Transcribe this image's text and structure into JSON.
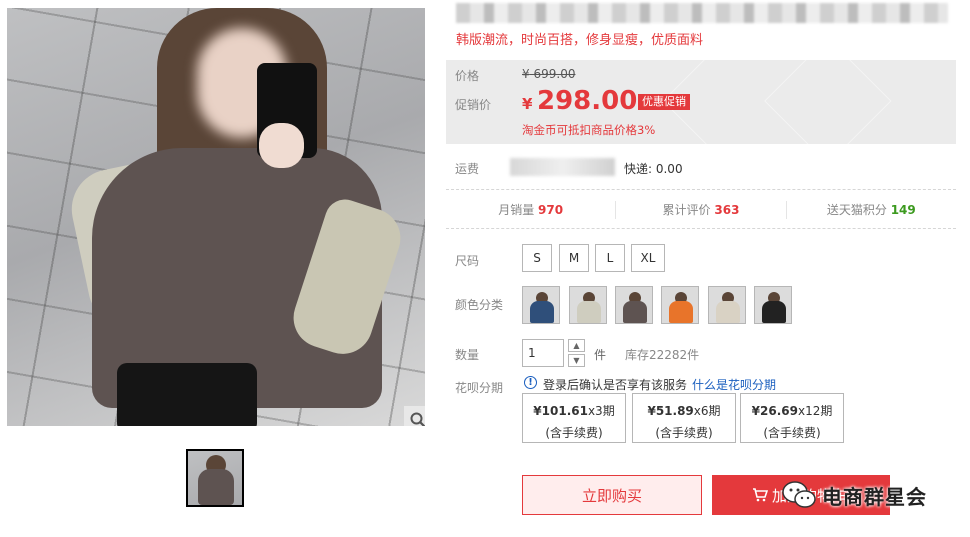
{
  "product": {
    "subtitle": "韩版潮流，时尚百搭，修身显瘦，优质面料"
  },
  "price": {
    "orig_label": "价格",
    "orig_currency": "¥",
    "orig_value": "699.00",
    "promo_label": "促销价",
    "currency": "¥",
    "value": "298.00",
    "promo_tag": "优惠促销",
    "coin_note": "淘金币可抵扣商品价格3%"
  },
  "shipping": {
    "label": "运费",
    "value": "快递: 0.00"
  },
  "stats": {
    "monthly_label": "月销量",
    "monthly_value": "970",
    "reviews_label": "累计评价",
    "reviews_value": "363",
    "points_label": "送天猫积分",
    "points_value": "149"
  },
  "size": {
    "label": "尺码",
    "options": [
      "S",
      "M",
      "L",
      "XL"
    ]
  },
  "color": {
    "label": "颜色分类",
    "swatches": [
      "#2f4f7a",
      "#cfcdbf",
      "#5e5351",
      "#e8742a",
      "#d9d2c4",
      "#222222"
    ]
  },
  "quantity": {
    "label": "数量",
    "value": "1",
    "unit": "件",
    "stock": "库存22282件"
  },
  "huabei": {
    "label": "花呗分期",
    "note": "登录后确认是否享有该服务",
    "link": "什么是花呗分期",
    "plans": [
      {
        "amount": "¥101.61",
        "term": "x3期",
        "fee": "(含手续费)"
      },
      {
        "amount": "¥51.89",
        "term": "x6期",
        "fee": "(含手续费)"
      },
      {
        "amount": "¥26.69",
        "term": "x12期",
        "fee": "(含手续费)"
      }
    ]
  },
  "actions": {
    "buy_now": "立即购买",
    "add_cart": "加入购物车"
  },
  "watermark": {
    "text": "电商群星会"
  },
  "colors": {
    "accent": "#e4393c",
    "link": "#1b5fbf",
    "points": "#3c9a1f"
  }
}
